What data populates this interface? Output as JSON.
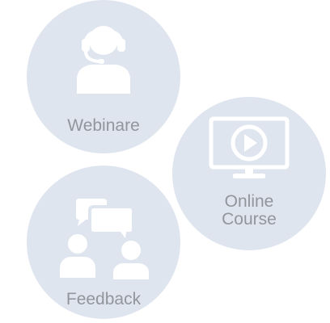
{
  "colors": {
    "circle_fill": "#dfe5ef",
    "icon_fill": "#ffffff",
    "label_text": "#91969c"
  },
  "items": [
    {
      "label": "Webinare",
      "icon": "headset-user-icon"
    },
    {
      "label_line1": "Online",
      "label_line2": "Course",
      "icon": "monitor-play-icon"
    },
    {
      "label": "Feedback",
      "icon": "people-chat-icon"
    }
  ]
}
